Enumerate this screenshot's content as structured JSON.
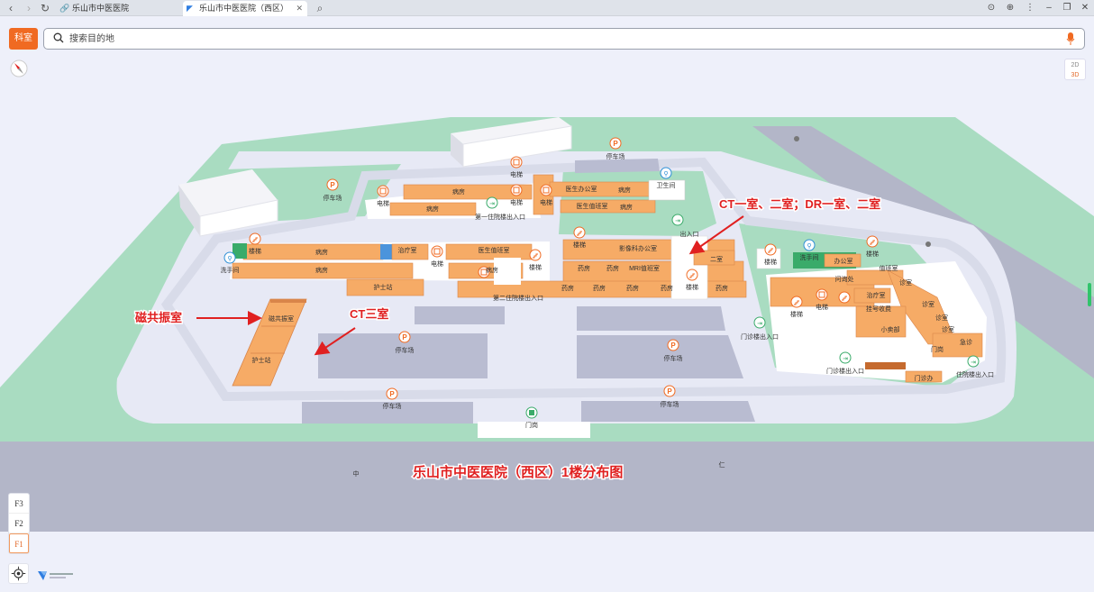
{
  "browser": {
    "tabs": [
      {
        "label": "乐山市中医医院",
        "active": false
      },
      {
        "label": "乐山市中医医院（西区）",
        "active": true
      }
    ]
  },
  "toolbar": {
    "dept_label": "科室",
    "search_placeholder": "搜索目的地"
  },
  "view_toggle": {
    "top": "2D",
    "bottom": "3D"
  },
  "floors": [
    "F3",
    "F2",
    "F1"
  ],
  "active_floor": "F1",
  "annotations": {
    "title": "乐山市中医医院（西区）1楼分布图",
    "ct_dr": "CT一室、二室；DR一室、二室",
    "mri": "磁共振室",
    "ct3": "CT三室"
  },
  "map_labels": {
    "parking": "停车场",
    "elevator": "电梯",
    "stairs": "楼梯",
    "ward": "病房",
    "toilet": "洗手间",
    "toilet2": "卫生间",
    "doctor_office": "医生办公室",
    "doctor_duty": "医生值班室",
    "nurse_station": "护士站",
    "pharmacy": "药房",
    "treatment": "治疗室",
    "consult": "诊室",
    "office": "办公室",
    "exit": "出入口",
    "outpatient_entrance": "门诊楼出入口",
    "ward_entrance": "住院楼出入口",
    "ward_entrance2": "第一住院楼出入口",
    "ward_entrance3": "第二住院楼出入口",
    "imaging_office": "影像科办公室",
    "mri_room": "磁共振室",
    "ct_room": "CT一室",
    "ct_room2": "二室",
    "dr_room": "DR室",
    "mri_duty": "MRI值班室",
    "ct_duty": "CT值班室",
    "shop": "小卖部",
    "registration": "挂号收费",
    "inquiry": "问询处",
    "duty_room": "值班室",
    "gate": "门岗",
    "emergency": "急诊",
    "office2": "门诊办",
    "road_left": "中",
    "road_right": "仁"
  },
  "colors": {
    "room": "#f6ab66",
    "room_dark": "#d9854a",
    "grass": "#a9dcc1",
    "plaza": "#e7e9f5",
    "road": "#b3b6c8",
    "parking": "#b9bcd1",
    "building_white": "#ffffff",
    "accent": "#f06a22",
    "annotation": "#e02020"
  }
}
